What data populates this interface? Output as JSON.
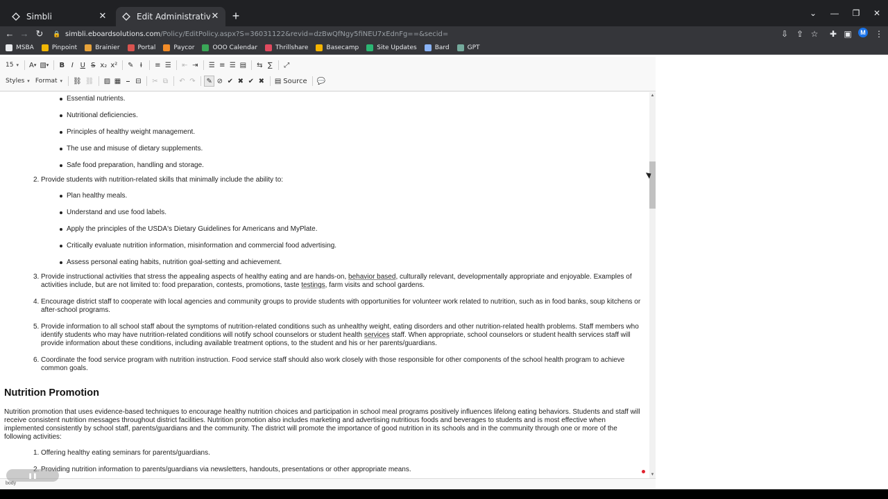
{
  "browser": {
    "tabs": [
      {
        "title": "Simbli",
        "active": false
      },
      {
        "title": "Edit Administrative Procedure AÀ",
        "active": true
      }
    ],
    "url_domain": "simbli.eboardsolutions.com",
    "url_path": "/Policy/EditPolicy.aspx?S=36031122&revid=dzBwQfNgy5fiNEU7xEdnFg==&secid=",
    "profile_initial": "M",
    "bookmarks": [
      {
        "label": "MSBA",
        "color": "#e8eaed"
      },
      {
        "label": "Pinpoint",
        "color": "#f2b705"
      },
      {
        "label": "Brainier",
        "color": "#e8a33a"
      },
      {
        "label": "Portal",
        "color": "#d9534f"
      },
      {
        "label": "Paycor",
        "color": "#f28c28"
      },
      {
        "label": "OOO Calendar",
        "color": "#3aa757"
      },
      {
        "label": "Thrillshare",
        "color": "#e04a5f"
      },
      {
        "label": "Basecamp",
        "color": "#f5b400"
      },
      {
        "label": "Site Updates",
        "color": "#2bb673"
      },
      {
        "label": "Bard",
        "color": "#8ab4f8"
      },
      {
        "label": "GPT",
        "color": "#74aa9c"
      }
    ]
  },
  "editor": {
    "font_size": "15",
    "styles_label": "Styles",
    "format_label": "Format",
    "source_label": "Source",
    "status_path": "body"
  },
  "document": {
    "bullets_a": [
      "Essential nutrients.",
      "Nutritional deficiencies.",
      "Principles of healthy weight management.",
      "The use and misuse of dietary supplements.",
      "Safe food preparation, handling and storage."
    ],
    "item2": {
      "num": "2.",
      "text": "Provide students with nutrition-related skills that minimally include the ability to:"
    },
    "bullets_b": [
      "Plan healthy meals.",
      "Understand and use food labels.",
      "Apply the principles of the USDA's Dietary Guidelines for Americans and MyPlate.",
      "Critically evaluate nutrition information, misinformation and commercial food advertising.",
      "Assess personal eating habits, nutrition goal-setting and achievement."
    ],
    "item3": {
      "num": "3.",
      "a": "Provide instructional activities that stress the appealing aspects of healthy eating and are hands-on, ",
      "b": "behavior based",
      "c": ", culturally relevant, developmentally appropriate and enjoyable. Examples of activities include, but are not limited to: food preparation, contests, promotions, taste ",
      "d": "testings",
      "e": ", farm visits and school gardens."
    },
    "item4": {
      "num": "4.",
      "text": "Encourage district staff to cooperate with local agencies and community groups to provide students with opportunities for volunteer work related to nutrition, such as in food banks, soup kitchens or after-school programs."
    },
    "item5": {
      "num": "5.",
      "a": "Provide information to all school staff about the symptoms of nutrition-related conditions such as unhealthy weight, eating disorders and other nutrition-related health problems. Staff members who identify students who may have nutrition-related conditions will notify school counselors or student health ",
      "b": "services",
      "c": " staff. When appropriate, school counselors or student health services staff will provide information about these conditions, including available treatment options, to the student and his or her parents/guardians."
    },
    "item6": {
      "num": "6.",
      "text": "Coordinate the food service program with nutrition instruction. Food service staff should also work closely with those responsible for other components of the school health program to achieve common goals."
    },
    "heading": "Nutrition Promotion",
    "paragraph": "Nutrition promotion that uses evidence-based techniques to encourage healthy nutrition choices and participation in school meal programs positively influences lifelong eating behaviors. Students and staff will receive consistent nutrition messages throughout district facilities. Nutrition promotion also includes marketing and advertising nutritious foods and beverages to students and is most effective when implemented consistently by school staff, parents/guardians and the community. The district will promote the importance of good nutrition in its schools and in the community through one or more of the following activities:",
    "promo_items": [
      {
        "num": "1.",
        "text": "Offering healthy eating seminars for parents/guardians."
      },
      {
        "num": "2.",
        "text": "Providing nutrition information to parents/guardians via newsletters, handouts, presentations or other appropriate means."
      }
    ]
  }
}
